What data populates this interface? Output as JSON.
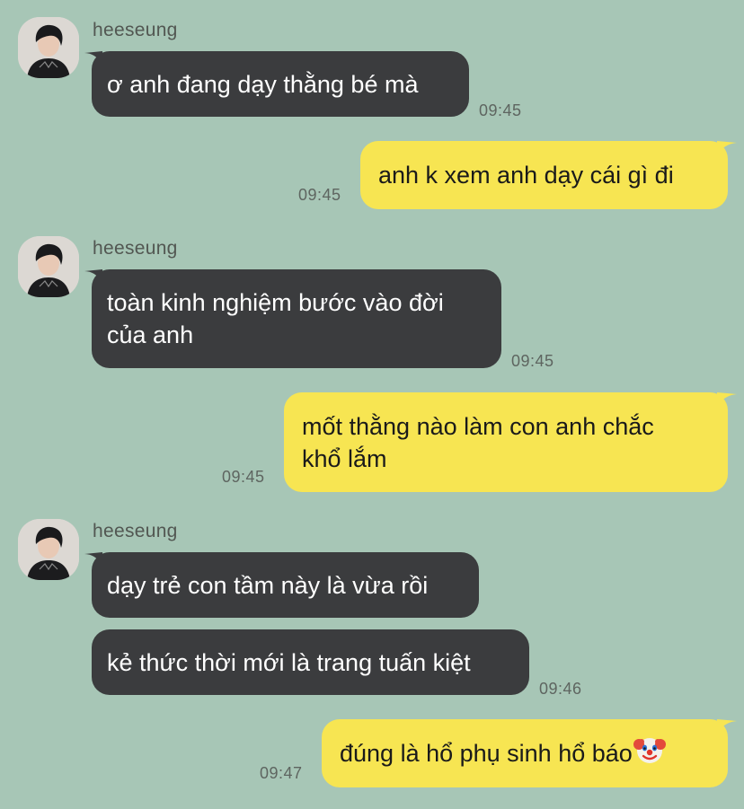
{
  "contact": {
    "name": "heeseung"
  },
  "messages": [
    {
      "id": "m1",
      "direction": "in",
      "text": "ơ anh đang dạy thằng bé mà",
      "time": "09:45"
    },
    {
      "id": "m2",
      "direction": "out",
      "text": "anh k xem anh dạy cái gì đi",
      "time": "09:45"
    },
    {
      "id": "m3",
      "direction": "in",
      "lines": [
        "toàn kinh nghiệm bước vào đời",
        "của anh"
      ],
      "time": "09:45"
    },
    {
      "id": "m4",
      "direction": "out",
      "lines": [
        "mốt thằng nào làm con anh chắc",
        "khổ lắm"
      ],
      "time": "09:45"
    },
    {
      "id": "m5",
      "direction": "in",
      "text": "dạy trẻ con tầm này là vừa rồi"
    },
    {
      "id": "m6",
      "direction": "in",
      "text": "kẻ thức thời mới là trang tuấn kiệt",
      "time": "09:46"
    },
    {
      "id": "m7",
      "direction": "out",
      "text": "đúng là hổ phụ sinh hổ báo",
      "emoji": "clown-face-icon",
      "time": "09:47"
    }
  ],
  "colors": {
    "background": "#a7c6b6",
    "incoming_bubble": "#3b3c3e",
    "outgoing_bubble": "#f7e552"
  }
}
